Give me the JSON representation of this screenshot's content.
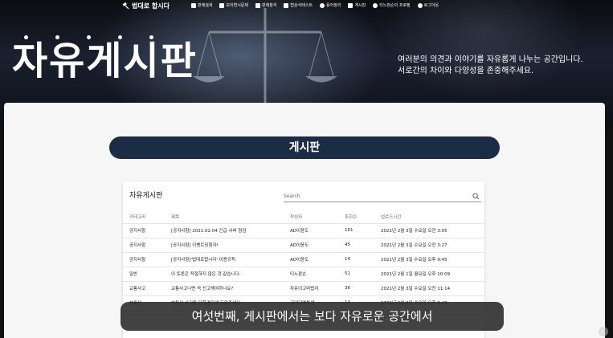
{
  "nav": {
    "brand": "법대로 합시다",
    "items": [
      {
        "label": "판례검색"
      },
      {
        "label": "모의변시문제"
      },
      {
        "label": "판례분석"
      },
      {
        "label": "법상식테스트"
      },
      {
        "label": "용어정리"
      },
      {
        "label": "게시판"
      },
      {
        "label": "티노판슨의 프로필"
      },
      {
        "label": "로그아웃"
      }
    ]
  },
  "hero": {
    "title": "자유게시판",
    "desc_line1": "여러분의 의견과 이야기를 자유롭게 나누는 공간입니다.",
    "desc_line2": "서로간의 차이와 다양성을 존중해주세요."
  },
  "board": {
    "banner": "게시판",
    "card_title": "자유게시판",
    "search_placeholder": "Search",
    "headers": [
      "카테고리",
      "제목",
      "작성자",
      "조회수",
      "업로드시간"
    ],
    "rows": [
      [
        "공지사항",
        "[공지사항] 2021.02.04 긴급 서버 점검",
        "AD이윤도",
        "161",
        "2021년 2월 3일 수요일 오전 3:05"
      ],
      [
        "공지사항",
        "[공지사항] 이벤트당첨자!",
        "AD이윤도",
        "45",
        "2021년 2월 3일 수요일 오전 3:27"
      ],
      [
        "공지사항",
        "[공지사항]'법대로합시다' 이용규칙",
        "AD이윤도",
        "14",
        "2021년 2월 3일 수요일 오후 9:45"
      ],
      [
        "일반",
        "이 토론은 적절하지 않은 것 같습니다.",
        "티노판슨",
        "51",
        "2021년 2월 1일 월요일 오후 10:09"
      ],
      [
        "교통사고",
        "교통사고나면 꼭 신고해야하나요?",
        "자유이고마법자",
        "36",
        "2021년 2월 3일 수요일 오전 11:14"
      ],
      [
        "부동산",
        "부동산 사기를 당한경우에 도와주세요",
        "고대기예동생",
        "14",
        "2021년 2월 3일 수요일 오후 9:43"
      ]
    ]
  },
  "caption": "여섯번째, 게시판에서는 보다 자유로운 공간에서"
}
